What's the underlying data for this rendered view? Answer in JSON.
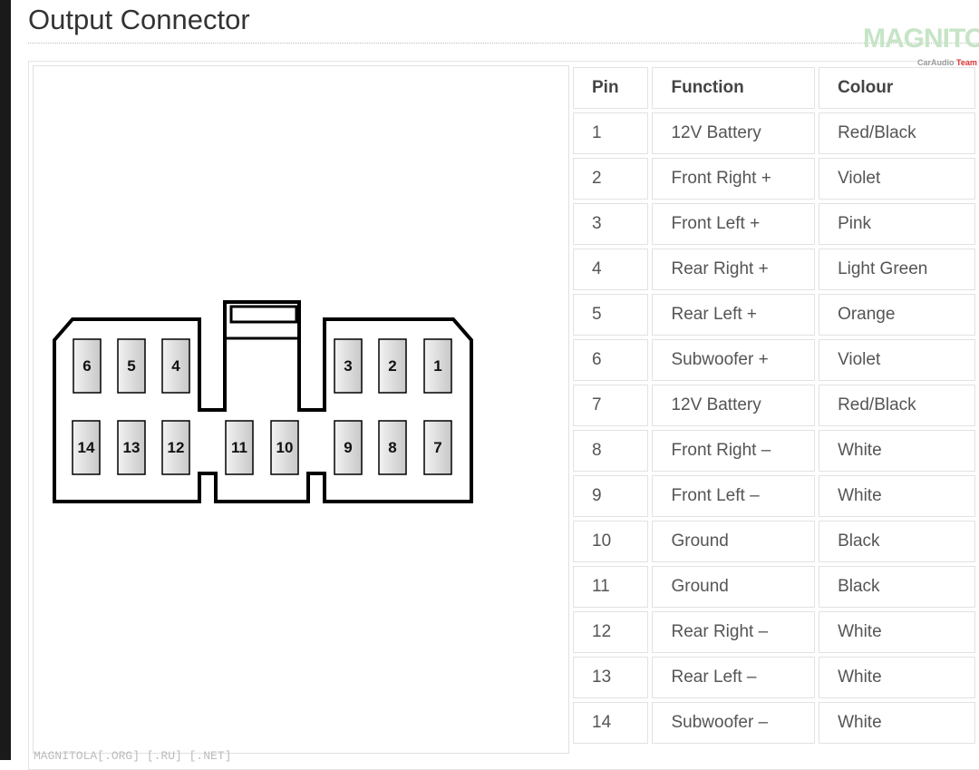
{
  "title": "Output Connector",
  "watermark": {
    "logo": "MAGNITOLA",
    "logo_sub": "CarAudio",
    "logo_sub_accent": "Team",
    "footer": "MAGNITOLA[.ORG] [.RU] [.NET]"
  },
  "diagram": {
    "top_row_pins": [
      "6",
      "5",
      "4",
      "3",
      "2",
      "1"
    ],
    "bottom_row_pins": [
      "14",
      "13",
      "12",
      "11",
      "10",
      "9",
      "8",
      "7"
    ]
  },
  "table": {
    "headers": [
      "Pin",
      "Function",
      "Colour"
    ],
    "rows": [
      [
        "1",
        "12V Battery",
        "Red/Black"
      ],
      [
        "2",
        "Front Right +",
        "Violet"
      ],
      [
        "3",
        "Front Left +",
        "Pink"
      ],
      [
        "4",
        "Rear Right +",
        "Light Green"
      ],
      [
        "5",
        "Rear Left +",
        "Orange"
      ],
      [
        "6",
        "Subwoofer +",
        "Violet"
      ],
      [
        "7",
        "12V Battery",
        "Red/Black"
      ],
      [
        "8",
        "Front Right –",
        "White"
      ],
      [
        "9",
        "Front Left –",
        "White"
      ],
      [
        "10",
        "Ground",
        "Black"
      ],
      [
        "11",
        "Ground",
        "Black"
      ],
      [
        "12",
        "Rear Right –",
        "White"
      ],
      [
        "13",
        "Rear Left –",
        "White"
      ],
      [
        "14",
        "Subwoofer –",
        "White"
      ]
    ]
  }
}
